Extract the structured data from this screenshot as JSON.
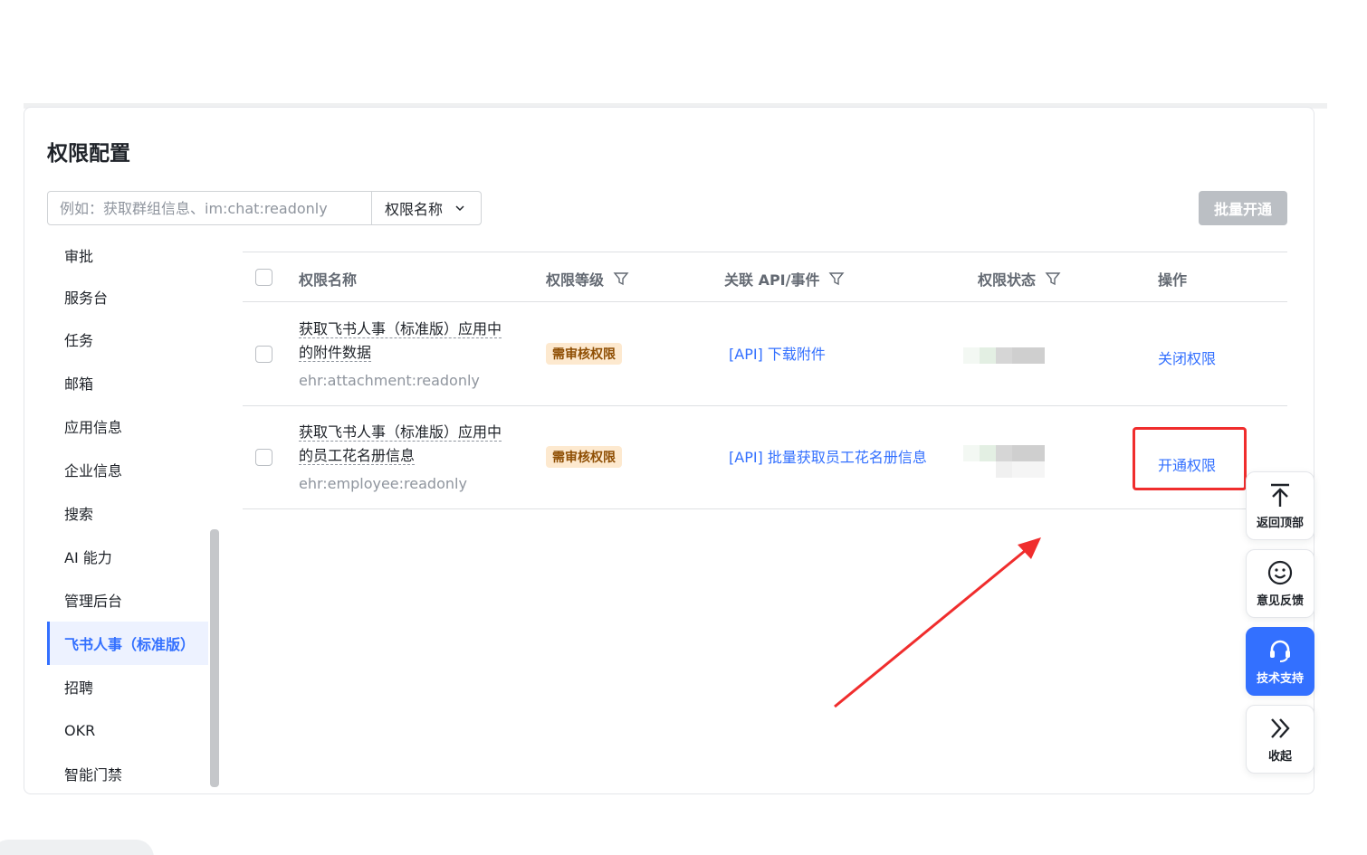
{
  "page": {
    "title": "权限配置",
    "search_placeholder": "例如：获取群组信息、im:chat:readonly",
    "select_value": "权限名称",
    "bulk_button": "批量开通"
  },
  "sidebar": {
    "items": [
      {
        "label": "审批",
        "active": false
      },
      {
        "label": "服务台",
        "active": false
      },
      {
        "label": "任务",
        "active": false
      },
      {
        "label": "邮箱",
        "active": false
      },
      {
        "label": "应用信息",
        "active": false
      },
      {
        "label": "企业信息",
        "active": false
      },
      {
        "label": "搜索",
        "active": false
      },
      {
        "label": "AI 能力",
        "active": false
      },
      {
        "label": "管理后台",
        "active": false
      },
      {
        "label": "飞书人事（标准版）",
        "active": true
      },
      {
        "label": "招聘",
        "active": false
      },
      {
        "label": "OKR",
        "active": false
      },
      {
        "label": "智能门禁",
        "active": false
      }
    ]
  },
  "table": {
    "headers": {
      "name": "权限名称",
      "level": "权限等级",
      "api": "关联 API/事件",
      "status": "权限状态",
      "action": "操作"
    },
    "rows": [
      {
        "name_line1": "获取飞书人事（标准版）应用中",
        "name_line2": "的附件数据",
        "code": "ehr:attachment:readonly",
        "level": "需审核权限",
        "api": "[API] 下载附件",
        "action": "关闭权限"
      },
      {
        "name_line1": "获取飞书人事（标准版）应用中",
        "name_line2": "的员工花名册信息",
        "code": "ehr:employee:readonly",
        "level": "需审核权限",
        "api": "[API] 批量获取员工花名册信息",
        "action": "开通权限"
      }
    ]
  },
  "float_buttons": {
    "top": "返回顶部",
    "feedback": "意见反馈",
    "support": "技术支持",
    "collapse": "收起"
  },
  "colors": {
    "accent": "#3370ff",
    "annotation": "#f02d2d",
    "tag_bg": "#fde9cf"
  }
}
